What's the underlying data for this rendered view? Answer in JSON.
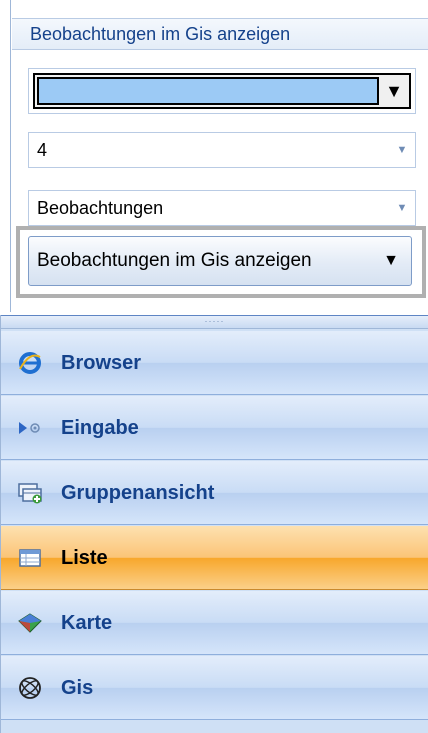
{
  "panel": {
    "title": "Beobachtungen im Gis anzeigen",
    "color_combo": {
      "color": "#9ccaf5",
      "arrow": "▼"
    },
    "number_combo": {
      "value": "4"
    },
    "type_combo": {
      "value": "Beobachtungen"
    },
    "action_button": {
      "label": "Beobachtungen im Gis anzeigen",
      "arrow": "▼"
    }
  },
  "splitter": {
    "grip": "·····"
  },
  "nav": {
    "items": [
      {
        "label": "Browser",
        "icon": "internet-explorer-icon"
      },
      {
        "label": "Eingabe",
        "icon": "input-arrow-icon"
      },
      {
        "label": "Gruppenansicht",
        "icon": "group-view-icon"
      },
      {
        "label": "Liste",
        "icon": "list-icon",
        "selected": true
      },
      {
        "label": "Karte",
        "icon": "map-icon"
      },
      {
        "label": "Gis",
        "icon": "globe-icon"
      }
    ]
  }
}
